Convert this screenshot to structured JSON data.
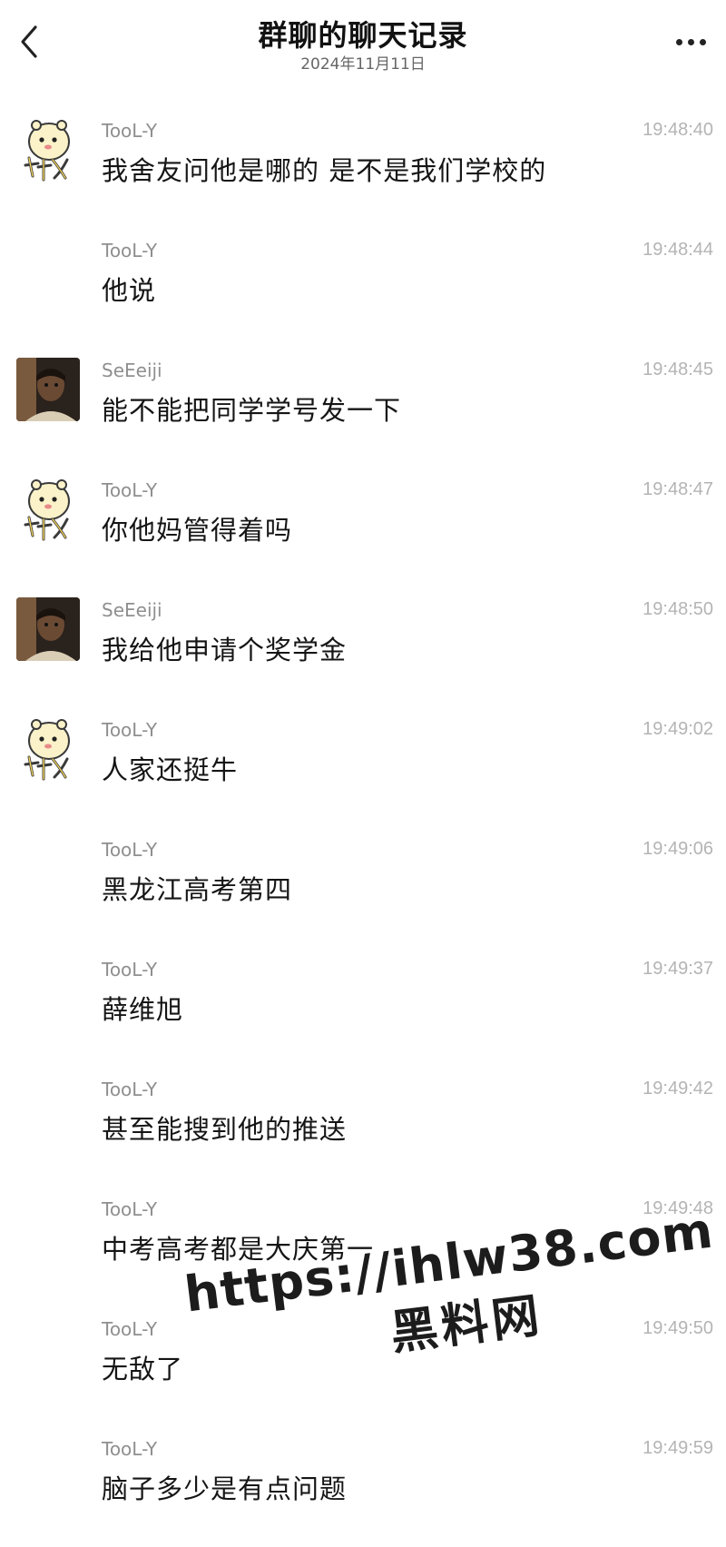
{
  "header": {
    "title": "群聊的聊天记录",
    "date": "2024年11月11日",
    "back_icon": "chevron-left-icon",
    "more_icon": "more-dots-icon"
  },
  "messages": [
    {
      "sender": "TooL-Y",
      "time": "19:48:40",
      "text": "我舍友问他是哪的 是不是我们学校的",
      "avatar": "cartoon"
    },
    {
      "sender": "TooL-Y",
      "time": "19:48:44",
      "text": "他说",
      "avatar": "none"
    },
    {
      "sender": "SeEeiji",
      "time": "19:48:45",
      "text": "能不能把同学学号发一下",
      "avatar": "photo"
    },
    {
      "sender": "TooL-Y",
      "time": "19:48:47",
      "text": "你他妈管得着吗",
      "avatar": "cartoon"
    },
    {
      "sender": "SeEeiji",
      "time": "19:48:50",
      "text": "我给他申请个奖学金",
      "avatar": "photo"
    },
    {
      "sender": "TooL-Y",
      "time": "19:49:02",
      "text": "人家还挺牛",
      "avatar": "cartoon"
    },
    {
      "sender": "TooL-Y",
      "time": "19:49:06",
      "text": "黑龙江高考第四",
      "avatar": "none"
    },
    {
      "sender": "TooL-Y",
      "time": "19:49:37",
      "text": "薛维旭",
      "avatar": "none"
    },
    {
      "sender": "TooL-Y",
      "time": "19:49:42",
      "text": "甚至能搜到他的推送",
      "avatar": "none"
    },
    {
      "sender": "TooL-Y",
      "time": "19:49:48",
      "text": "中考高考都是大庆第一",
      "avatar": "none"
    },
    {
      "sender": "TooL-Y",
      "time": "19:49:50",
      "text": "无敌了",
      "avatar": "none"
    },
    {
      "sender": "TooL-Y",
      "time": "19:49:59",
      "text": "脑子多少是有点问题",
      "avatar": "none"
    }
  ],
  "watermark": {
    "url": "https://ihlw38.com",
    "name": "黑料网"
  }
}
